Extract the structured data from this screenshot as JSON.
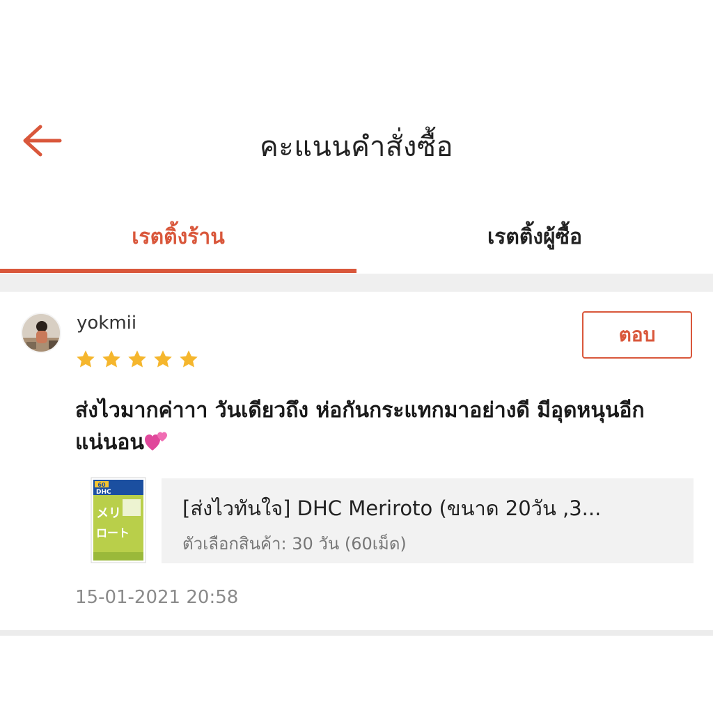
{
  "header": {
    "title": "คะแนนคำสั่งซื้อ",
    "back_icon": "arrow-left-icon",
    "accent_color": "#d9573b"
  },
  "tabs": [
    {
      "label": "เรตติ้งร้าน",
      "active": true
    },
    {
      "label": "เรตติ้งผู้ซื้อ",
      "active": false
    }
  ],
  "review": {
    "avatar_icon": "user-avatar",
    "username": "yokmii",
    "rating": 5,
    "rating_max": 5,
    "star_color": "#f5b62d",
    "reply_label": "ตอบ",
    "comment": "ส่งไวมากค่าาา วันเดียวถึง ห่อกันกระแทกมาอย่างดี มีอุดหนุนอีกแน่นอน",
    "comment_emoji": "two-hearts-icon",
    "product": {
      "thumbnail_icon": "product-thumbnail",
      "thumbnail_text": [
        "60",
        "DHC",
        "メリ",
        "ロート"
      ],
      "name": "[ส่งไวทันใจ] DHC Meriroto (ขนาด 20วัน ,3...",
      "variant": "ตัวเลือกสินค้า: 30 วัน (60เม็ด)"
    },
    "timestamp": "15-01-2021 20:58"
  }
}
